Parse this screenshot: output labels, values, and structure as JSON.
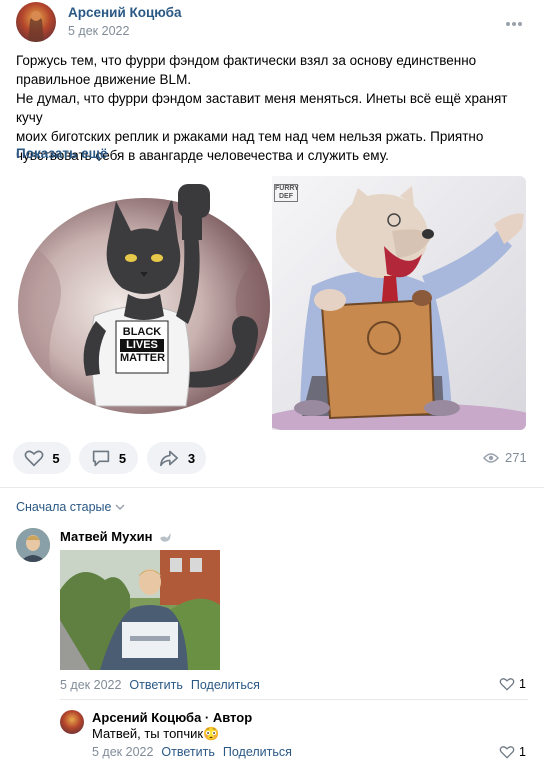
{
  "post": {
    "author": "Арсений Коцюба",
    "date": "5 дек 2022",
    "text_lines": [
      "Горжусь тем, что фурри фэндом фактически взял за основу единственно",
      "правильное движение BLM.",
      "Не думал, что фурри фэндом заставит меня меняться. Инеты всё ещё хранят кучу",
      "моих биготских реплик и ржаками над тем над чем нельзя ржать. Приятно",
      "чувствовать себя в авангарде человечества и служить ему."
    ],
    "show_more": "Показать ещё",
    "images": {
      "cat_shirt": [
        "BLACK",
        "LIVES",
        "MATTER"
      ],
      "bear_tag": "FURRY DEF"
    },
    "actions": {
      "likes": "5",
      "comments": "5",
      "shares": "3",
      "views": "271"
    }
  },
  "comments_header": {
    "sort_label": "Сначала старые"
  },
  "comments": [
    {
      "author": "Матвей Мухин",
      "date": "5 дек 2022",
      "reply_label": "Ответить",
      "share_label": "Поделиться",
      "likes": "1",
      "badge_icon": "dove-icon"
    },
    {
      "author": "Арсений Коцюба · Автор",
      "text": "Матвей, ты топчик😳",
      "date": "5 дек 2022",
      "reply_label": "Ответить",
      "share_label": "Поделиться",
      "likes": "1"
    }
  ],
  "colors": {
    "link": "#2a5885",
    "meta": "#818c99",
    "pill_bg": "#f0f2f5",
    "separator": "#e7e8ec"
  }
}
